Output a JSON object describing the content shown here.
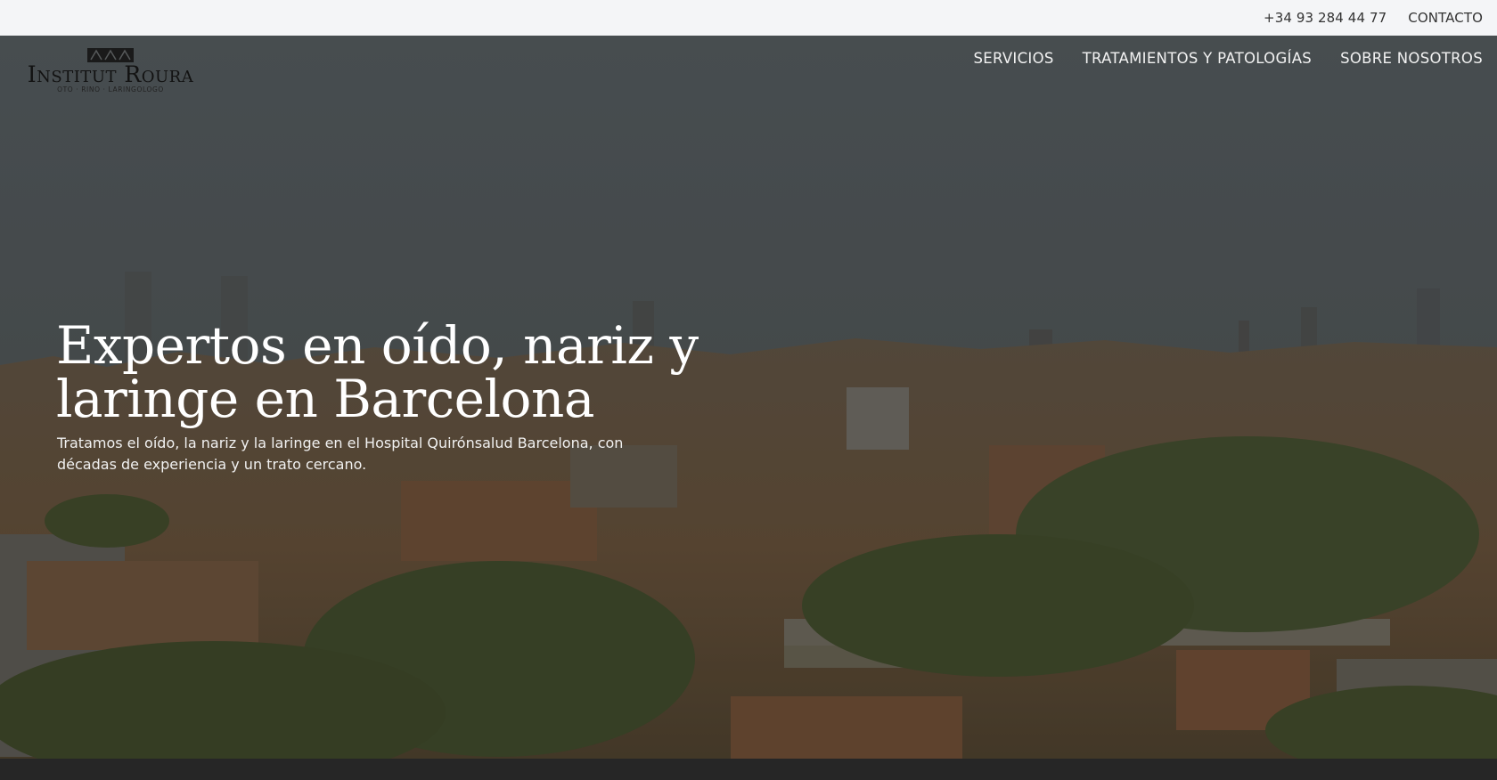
{
  "topbar": {
    "phone": "+34 93 284 44 77",
    "contact": "CONTACTO"
  },
  "logo": {
    "name": "Institut Roura",
    "tagline": "OTO · RINO · LARINGOLOGO",
    "icon": "logo-mark-icon"
  },
  "nav": {
    "items": [
      "SERVICIOS",
      "TRATAMIENTOS Y PATOLOGÍAS",
      "SOBRE NOSOTROS"
    ]
  },
  "hero": {
    "headline_line1": "Expertos en oído, nariz y",
    "headline_line2": "laringe en Barcelona",
    "subtitle_line1": "Tratamos el oído, la nariz y la laringe en el Hospital Quirónsalud Barcelona, con",
    "subtitle_line2": "décadas de experiencia y un trato cercano."
  },
  "colors": {
    "topbar_bg": "#f4f5f7",
    "nav_text": "#f2f2f2",
    "footer_bg": "#262626"
  }
}
